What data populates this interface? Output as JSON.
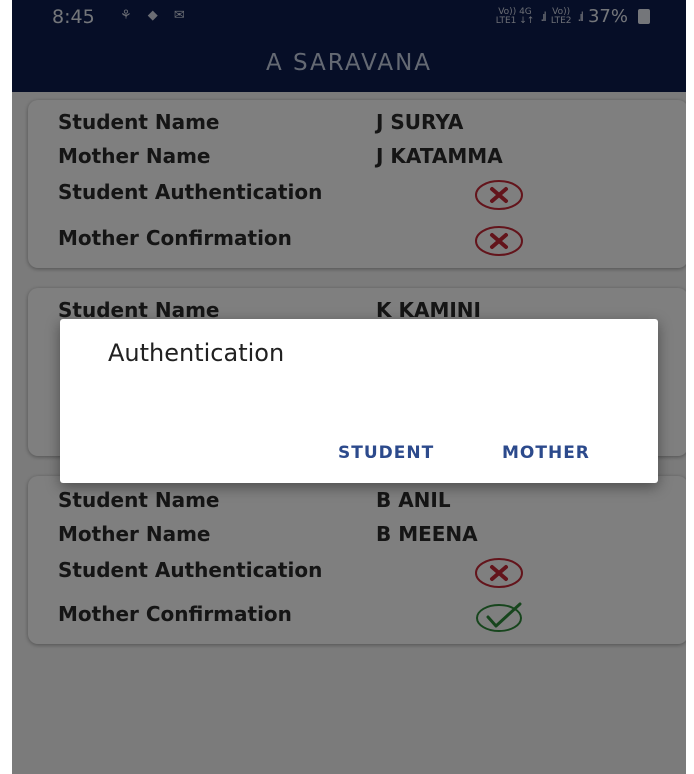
{
  "status_bar": {
    "time": "8:45",
    "network_top": "Vo)) 4G",
    "network_bottom": "LTE1 ↓↑",
    "network2_top": "Vo))",
    "network2_bottom": "LTE2",
    "battery": "37%"
  },
  "app_bar": {
    "title": "A SARAVANA"
  },
  "labels": {
    "student_name": "Student Name",
    "mother_name": "Mother Name",
    "student_authentication": "Student Authentication",
    "mother_confirmation": "Mother Confirmation"
  },
  "students": [
    {
      "student_name": "J SURYA",
      "mother_name": "J KATAMMA",
      "student_authenticated": false,
      "mother_confirmed": false
    },
    {
      "student_name": "K KAMINI"
    },
    {
      "student_name": "B ANIL",
      "mother_name": "B MEENA",
      "student_authenticated": false,
      "mother_confirmed": true
    }
  ],
  "dialog": {
    "title": "Authentication",
    "student_button": "STUDENT",
    "mother_button": "MOTHER"
  },
  "colors": {
    "primary": "#0c1d4f",
    "error": "#c62837",
    "success": "#2e8b3a",
    "dialog_button": "#2c4a8c"
  }
}
